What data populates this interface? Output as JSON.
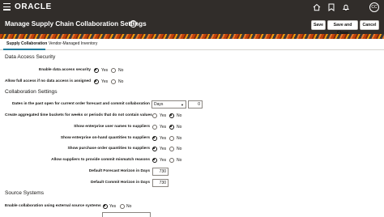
{
  "global": {
    "logo": "ORACLE",
    "avatar_initials": "CC"
  },
  "header": {
    "title": "Manage Supply Chain Collaboration Settings",
    "save_label": "Save",
    "save_close_label": "Save and Close",
    "cancel_label": "Cancel"
  },
  "tabs": [
    {
      "label": "Supply Collaboration",
      "active": true
    },
    {
      "label": "Vendor-Managed Inventory",
      "active": false
    }
  ],
  "data_access": {
    "heading": "Data Access Security",
    "rows": [
      {
        "label": "Enable data access security",
        "selected": "Yes"
      },
      {
        "label": "Allow full access if no data access is assigned",
        "selected": "Yes"
      }
    ]
  },
  "collaboration": {
    "heading": "Collaboration Settings",
    "dates_label": "Dates in the past open for current order forecast and commit collaboration",
    "dates_unit": "Days",
    "dates_value": "0",
    "rows": [
      {
        "label": "Create aggregated time buckets for weeks or periods that do not contain values",
        "selected": "No"
      },
      {
        "label": "Show enterprise user names to suppliers",
        "selected": "No"
      },
      {
        "label": "Show enterprise on-hand quantities to suppliers",
        "selected": "Yes"
      },
      {
        "label": "Show purchase order quantities to suppliers",
        "selected": "Yes"
      },
      {
        "label": "Allow suppliers to provide commit mismatch reasons",
        "selected": "Yes"
      }
    ],
    "forecast_horizon_label": "Default Forecast Horizon in Days",
    "forecast_horizon_value": "730",
    "commit_horizon_label": "Default Commit Horizon in Days",
    "commit_horizon_value": "730"
  },
  "source_systems": {
    "heading": "Source Systems",
    "rows": [
      {
        "label": "Enable collaboration using external source systems",
        "selected": "Yes"
      }
    ]
  },
  "options": {
    "yes": "Yes",
    "no": "No"
  }
}
